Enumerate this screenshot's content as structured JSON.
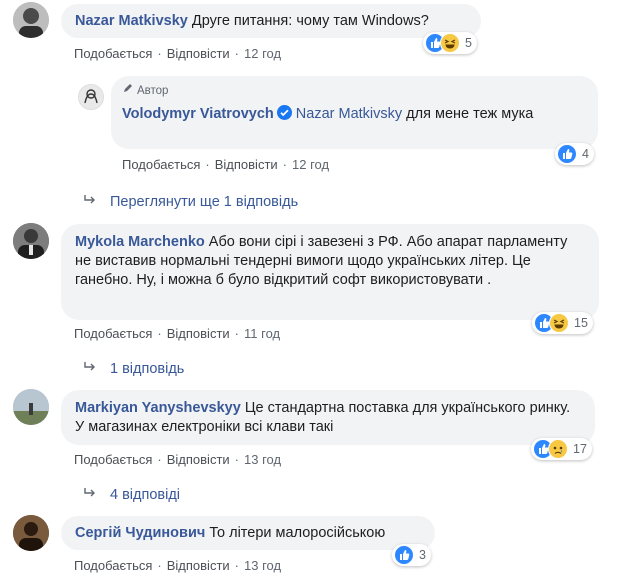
{
  "actions": {
    "like": "Подобається",
    "reply": "Відповісти",
    "sep": "·"
  },
  "comments": [
    {
      "author": "Nazar Matkivsky",
      "text": "Друге питання: чому там Windows?",
      "time": "12 год",
      "reactions": [
        "like-icon",
        "haha-icon"
      ],
      "reaction_count": "5"
    },
    {
      "badge": "Автор",
      "author": "Volodymyr Viatrovych",
      "mention": "Nazar Matkivsky",
      "text": "для мене теж мука",
      "time": "12 год",
      "reactions": [
        "like-icon"
      ],
      "reaction_count": "4"
    },
    {
      "author": "Mykola Marchenko",
      "text": "Або вони сірі і завезені з РФ. Або апарат парламенту не виставив нормальні тендерні вимоги щодо українських літер. Це ганебно. Ну, і можна б було відкритий софт використовувати .",
      "time": "11 год",
      "reactions": [
        "like-icon",
        "haha-icon"
      ],
      "reaction_count": "15"
    },
    {
      "author": "Markiyan Yanyshevskyy",
      "text": "Це стандартна поставка для українського ринку. У магазинах електроніки всі клави такі",
      "time": "13 год",
      "reactions": [
        "like-icon",
        "sad-icon"
      ],
      "reaction_count": "17"
    },
    {
      "author": "Сергій Чудинович",
      "text": "То літери малоросійською",
      "time": "13 год",
      "reactions": [
        "like-icon"
      ],
      "reaction_count": "3"
    }
  ],
  "more_replies": [
    "Переглянути ще 1 відповідь",
    "1 відповідь",
    "4 відповіді"
  ],
  "colors": {
    "link": "#385898",
    "bubble": "#f2f3f5",
    "like": "#2d88ff",
    "emoji": "#f7c843"
  }
}
